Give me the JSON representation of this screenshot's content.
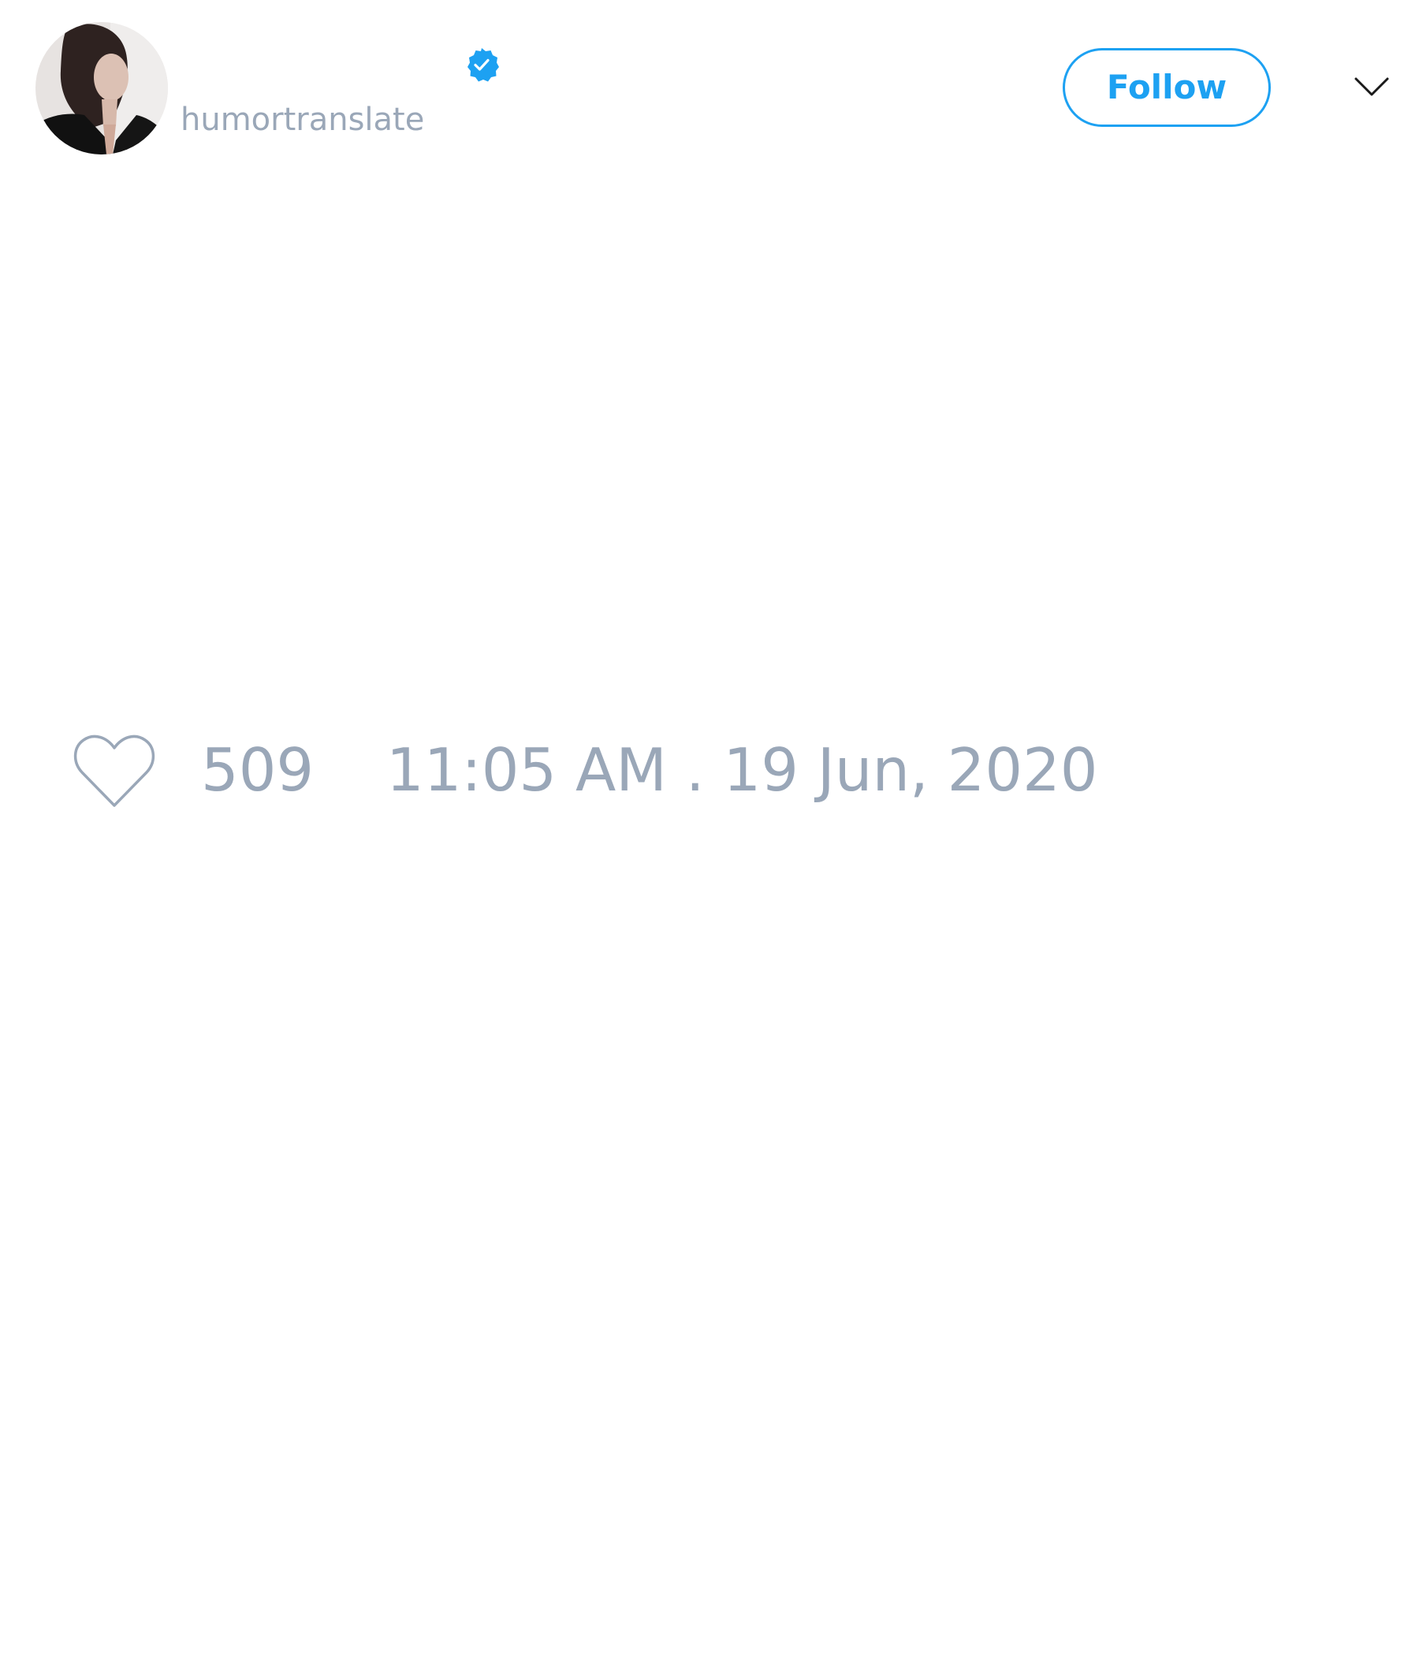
{
  "tweet": {
    "author": {
      "handle": "humortranslate",
      "verified": true,
      "avatar": "avatar-photo"
    },
    "follow_label": "Follow",
    "menu_icon": "chevron-down-icon",
    "likes": {
      "icon": "heart-icon",
      "count": "509"
    },
    "timestamp": "11:05 AM . 19 Jun, 2020"
  },
  "colors": {
    "accent": "#1da1f2",
    "muted_text": "#9aa7b8",
    "background": "#ffffff"
  }
}
